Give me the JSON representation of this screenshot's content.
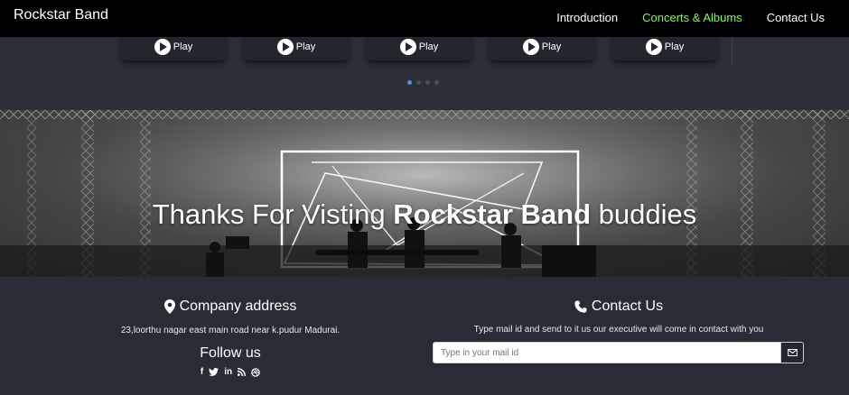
{
  "navbar": {
    "brand": "Rockstar Band",
    "links": [
      {
        "label": "Introduction",
        "active": false
      },
      {
        "label": "Concerts & Albums",
        "active": true
      },
      {
        "label": "Contact Us",
        "active": false
      }
    ]
  },
  "players": {
    "cards": [
      {
        "play_label": "Play"
      },
      {
        "play_label": "Play"
      },
      {
        "play_label": "Play"
      },
      {
        "play_label": "Play"
      },
      {
        "play_label": "Play"
      }
    ],
    "carousel": {
      "count": 4,
      "active_index": 0
    }
  },
  "banner": {
    "text_before": "Thanks For Visting ",
    "text_bold": "Rockstar Band",
    "text_after": " buddies"
  },
  "footer": {
    "address": {
      "heading": "Company address",
      "icon": "map-marker-icon",
      "text": "23,loorthu nagar east main road near k.pudur Madurai."
    },
    "follow": {
      "heading": "Follow us",
      "socials": [
        "facebook-icon",
        "twitter-icon",
        "linkedin-icon",
        "rss-icon",
        "dribbble-icon"
      ]
    },
    "contact": {
      "heading": "Contact Us",
      "icon": "phone-icon",
      "description": "Type mail id and send to it us our executive will come in contact with you",
      "input_placeholder": "Type in your mail id",
      "button_icon": "envelope-icon"
    }
  },
  "colors": {
    "nav_active": "#7cff3c",
    "dot_active": "#4a8fe8",
    "page_bg": "#282c34"
  }
}
